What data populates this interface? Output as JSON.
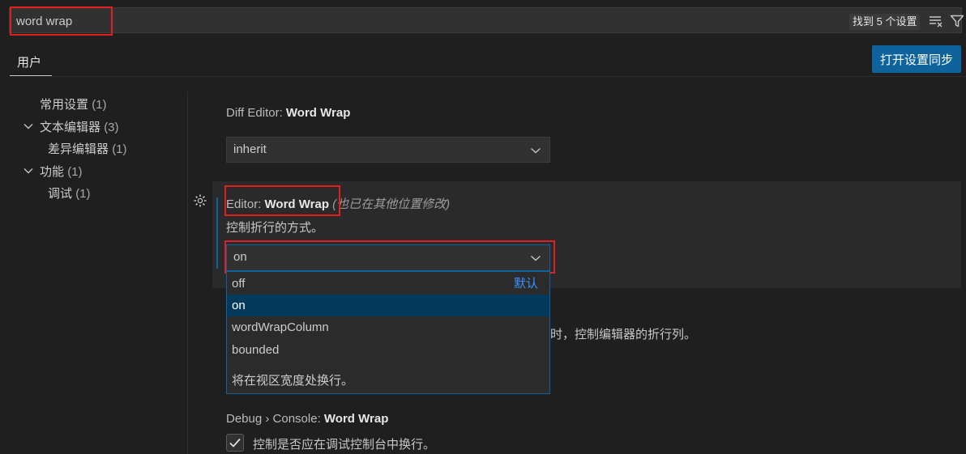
{
  "search": {
    "value": "word wrap",
    "result_count": "找到 5 个设置"
  },
  "header": {
    "tab_user": "用户",
    "sync_button": "打开设置同步"
  },
  "tree": [
    {
      "label": "常用设置",
      "count": "(1)"
    },
    {
      "label": "文本编辑器",
      "count": "(3)"
    },
    {
      "label": "差异编辑器",
      "count": "(1)"
    },
    {
      "label": "功能",
      "count": "(1)"
    },
    {
      "label": "调试",
      "count": "(1)"
    }
  ],
  "settings": {
    "diff_editor": {
      "category": "Diff Editor: ",
      "name": "Word Wrap",
      "value": "inherit"
    },
    "editor": {
      "category": "Editor: ",
      "name": "Word Wrap",
      "modified_note": "(也已在其他位置修改)",
      "description": "控制折行的方式。",
      "value": "on",
      "options": [
        "off",
        "on",
        "wordWrapColumn",
        "bounded"
      ],
      "default_label": "默认",
      "option_description": "将在视区宽度处换行。"
    },
    "hidden_description_tail": "时，控制编辑器的折行列。",
    "debug_console": {
      "category": "Debug › Console: ",
      "name": "Word Wrap",
      "description": "控制是否应在调试控制台中换行。",
      "checked": true
    }
  },
  "colors": {
    "accent": "#0e639c",
    "highlight": "#e02020",
    "selected_option": "#04395e",
    "default_label": "#3794ff"
  }
}
